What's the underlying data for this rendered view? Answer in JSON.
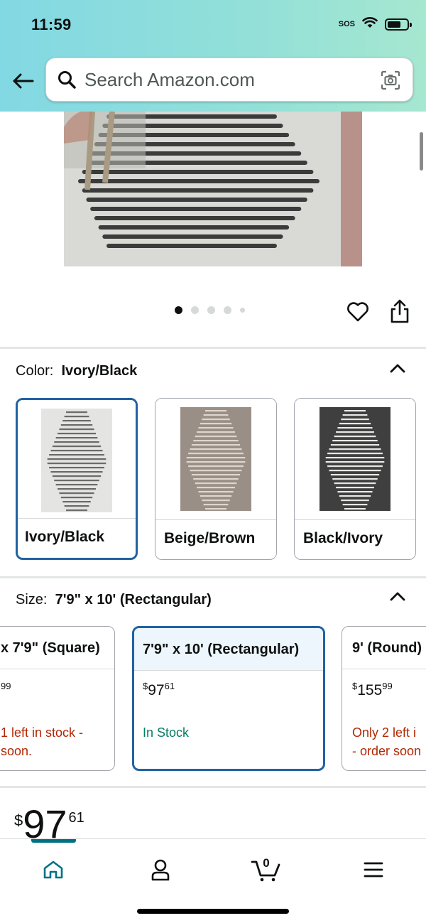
{
  "status_bar": {
    "time": "11:59",
    "sos": "SOS"
  },
  "search": {
    "placeholder": "Search Amazon.com"
  },
  "carousel": {
    "dot_count": 5,
    "active_index": 0
  },
  "color": {
    "label": "Color:",
    "selected": "Ivory/Black",
    "options": [
      {
        "name": "Ivory/Black",
        "selected": true
      },
      {
        "name": "Beige/Brown",
        "selected": false
      },
      {
        "name": "Black/Ivory",
        "selected": false
      }
    ]
  },
  "size": {
    "label": "Size:",
    "selected": "7'9\" x 10' (Rectangular)",
    "options": [
      {
        "name": "x 7'9\" (Square)",
        "price_whole": "",
        "price_frac": "99",
        "stock": [
          "1 left in stock -",
          "soon."
        ],
        "stock_status": "low"
      },
      {
        "name": "7'9\" x 10' (Rectangular)",
        "price_whole": "97",
        "price_frac": "61",
        "stock": [
          "In Stock"
        ],
        "stock_status": "in",
        "selected": true
      },
      {
        "name": "9' (Round)",
        "price_whole": "155",
        "price_frac": "99",
        "stock": [
          "Only 2 left i",
          "- order soon"
        ],
        "stock_status": "low"
      }
    ]
  },
  "price": {
    "currency": "$",
    "whole": "97",
    "fraction": "61"
  },
  "bottom_nav": {
    "active": "home",
    "items": [
      "home-icon",
      "account-icon",
      "cart-icon",
      "menu-icon"
    ],
    "cart_count": "0"
  },
  "colors": {
    "selected_border": "#2162a1",
    "red_stock": "#b12704",
    "green_stock": "#067d62",
    "teal_accent": "#007185"
  }
}
